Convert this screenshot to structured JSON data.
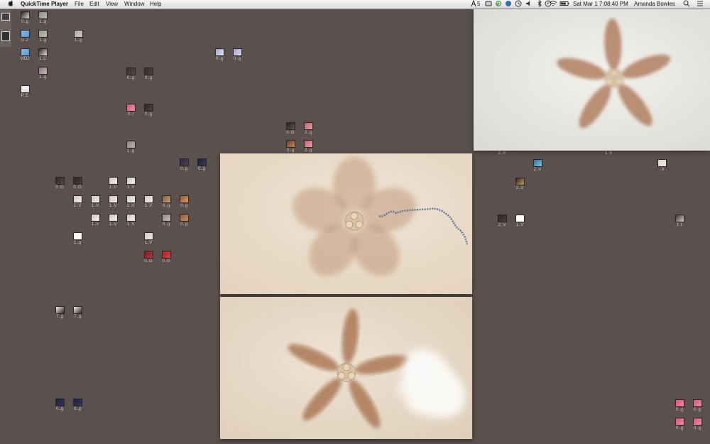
{
  "menubar": {
    "apple": "",
    "app_name": "QuickTime Player",
    "menus": [
      "File",
      "Edit",
      "View",
      "Window",
      "Help"
    ],
    "status_text": "5",
    "clock": "Sat Mar 1  7:08:40 PM",
    "user": "Amanda Bowles"
  },
  "desktop_labels": {
    "i_sa": "0..g",
    "i_sb": "1..g",
    "i_f1": "o..2",
    "i_f1b": "1..g",
    "i_doc": "1..g",
    "i_vid": "VID2",
    "i_c1": "1..C",
    "i_c2": "1..g",
    "i_pe": "P..E",
    "i_a1": "0..g",
    "i_a2": "0..g",
    "i_b1": "0..g",
    "i_b2": "0..g",
    "i_pk": "0..r",
    "i_pk2": "0..g",
    "i_g1": "1..g",
    "i_m1": "0..G",
    "i_m2": "2..g",
    "i_m3": "0..g",
    "i_m4": "2..g",
    "i_n1": "0..g",
    "i_n2": "0..g",
    "i_r1": "0..G",
    "i_r2": "0..G",
    "i_r3": "1..V",
    "i_r4": "1..V",
    "i_r5": "1..V",
    "i_r6": "1..V",
    "i_r7": "1..V",
    "i_r8": "1..V",
    "i_r9": "1..V",
    "i_r10": "0..g",
    "i_r11": "0..g",
    "i_r12": "1..V",
    "i_r13": "1..V",
    "i_r14": "1..V",
    "i_r15": "0..g",
    "i_r16": "0..g",
    "i_w1": "1..g",
    "i_v1": "1..V",
    "i_red1": "0..G",
    "i_red2": "0..G",
    "i_s1": "7..g",
    "i_s2": "7..g",
    "i_d1": "0..g",
    "i_d2": "0..g",
    "i_t1": "2..V",
    "i_t2": "1..V",
    "i_t3": "2..V",
    "i_t4": "..V",
    "i_t5": "2..V",
    "i_t6": "2..V",
    "i_t7": "1..V",
    "i_t8": "f..t",
    "i_p1": "0..g",
    "i_p2": "0..g",
    "i_p3": "0..g",
    "i_p4": "0..g"
  },
  "colors": {
    "desktop_bg": "#5a514e",
    "ceiling_top": "#efede8",
    "ceiling_right": "#efe1cf",
    "ceiling_bottom": "#ecdfd0",
    "blade": "#a8724f"
  },
  "windows": [
    {
      "name": "top-right",
      "blades": 5,
      "pull_chain": false,
      "smoke": false
    },
    {
      "name": "middle",
      "blades": 5,
      "pull_chain": true,
      "smoke": false
    },
    {
      "name": "bottom",
      "blades": 5,
      "pull_chain": false,
      "smoke": true
    }
  ]
}
